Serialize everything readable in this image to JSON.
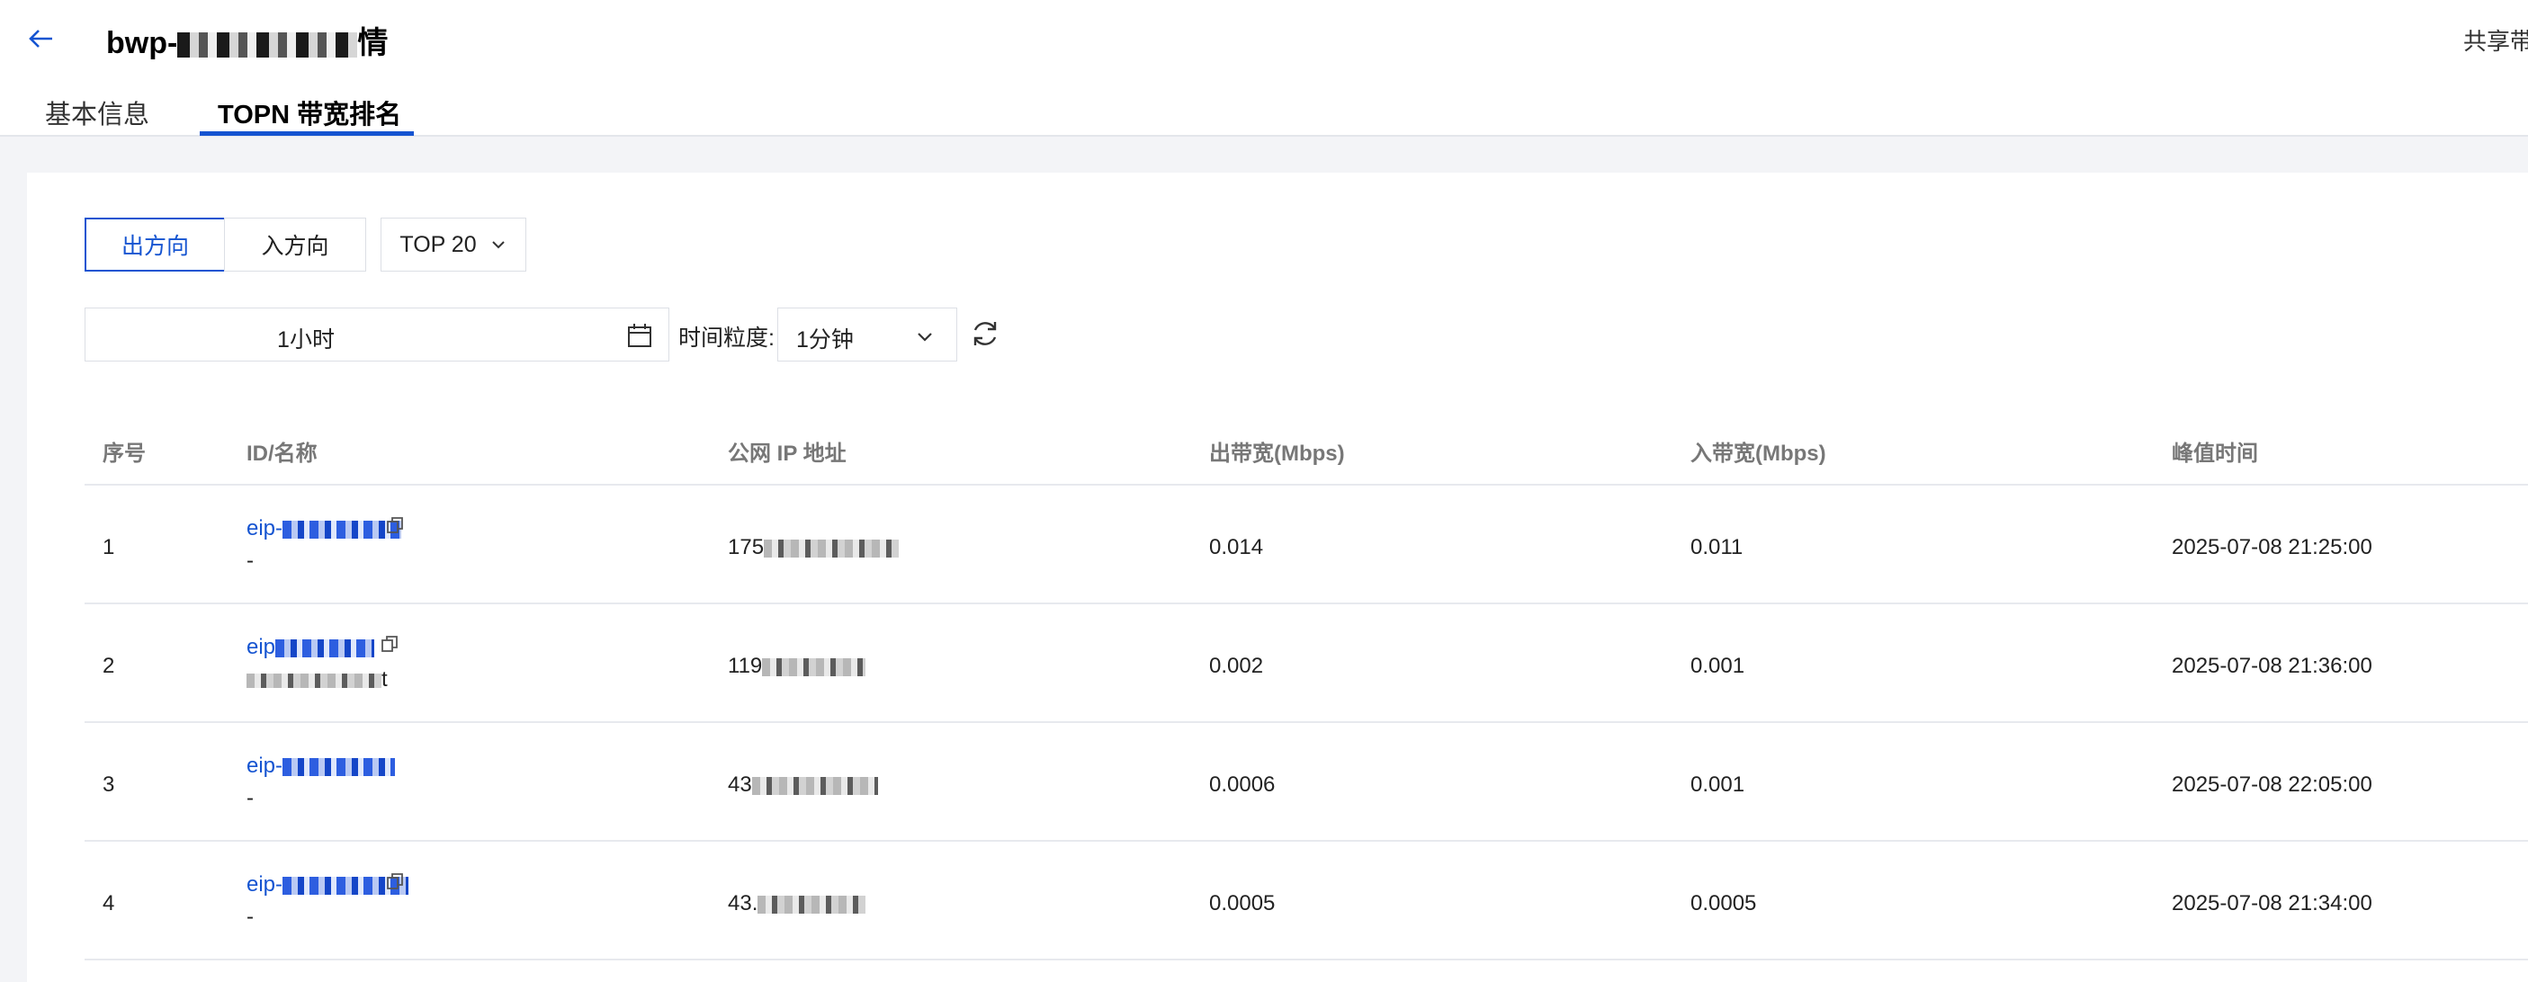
{
  "header": {
    "title_prefix": "bwp-",
    "title_suffix": "情",
    "top_right_label": "共享带",
    "tabs": [
      {
        "label": "基本信息"
      },
      {
        "label": "TOPN 带宽排名"
      }
    ]
  },
  "toolbar": {
    "direction_out_label": "出方向",
    "direction_in_label": "入方向",
    "top_select_value": "TOP 20",
    "time_range_value": "1小时",
    "granularity_label": "时间粒度:",
    "granularity_value": "1分钟"
  },
  "table": {
    "columns": [
      "序号",
      "ID/名称",
      "公网 IP 地址",
      "出带宽(Mbps)",
      "入带宽(Mbps)",
      "峰值时间"
    ],
    "rows": [
      {
        "index": "1",
        "id": "eip-",
        "name": "-",
        "ip": "175",
        "out_bw": "0.014",
        "in_bw": "0.011",
        "peak_time": "2025-07-08 21:25:00"
      },
      {
        "index": "2",
        "id": "eip",
        "name": "t",
        "ip": "119",
        "out_bw": "0.002",
        "in_bw": "0.001",
        "peak_time": "2025-07-08 21:36:00"
      },
      {
        "index": "3",
        "id": "eip-",
        "name": "-",
        "ip": "43",
        "out_bw": "0.0006",
        "in_bw": "0.001",
        "peak_time": "2025-07-08 22:05:00"
      },
      {
        "index": "4",
        "id": "eip-",
        "name": "-",
        "ip": "43.",
        "out_bw": "0.0005",
        "in_bw": "0.0005",
        "peak_time": "2025-07-08 21:34:00"
      }
    ]
  },
  "colors": {
    "accent": "#1554d1",
    "background": "#f3f4f7",
    "border": "#dcdfe5"
  },
  "icons": [
    "back-arrow-icon",
    "chevron-down-icon",
    "calendar-icon",
    "refresh-icon",
    "copy-icon"
  ]
}
